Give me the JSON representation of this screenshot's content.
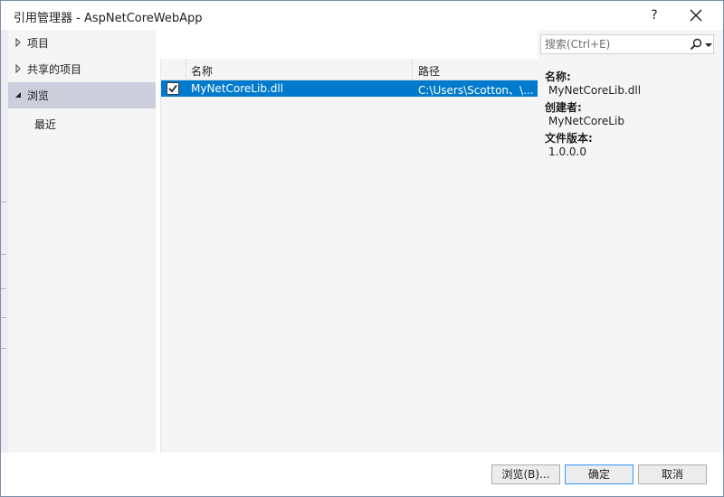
{
  "window": {
    "title": "引用管理器 - AspNetCoreWebApp",
    "help_label": "?"
  },
  "sidebar": {
    "items": [
      {
        "label": "项目",
        "expanded": false
      },
      {
        "label": "共享的项目",
        "expanded": false
      },
      {
        "label": "浏览",
        "expanded": true,
        "selected": true
      },
      {
        "label": "最近",
        "child": true
      }
    ]
  },
  "list": {
    "columns": [
      "名称",
      "路径"
    ],
    "rows": [
      {
        "checked": true,
        "name": "MyNetCoreLib.dll",
        "path": "C:\\Users\\Scotton、\\..."
      }
    ]
  },
  "search": {
    "placeholder": "搜索(Ctrl+E)"
  },
  "details": {
    "name_label": "名称:",
    "name_value": "MyNetCoreLib.dll",
    "creator_label": "创建者:",
    "creator_value": "MyNetCoreLib",
    "version_label": "文件版本:",
    "version_value": "1.0.0.0"
  },
  "footer": {
    "browse_label": "浏览(B)...",
    "ok_label": "确定",
    "cancel_label": "取消"
  },
  "colors": {
    "selection": "#007acc",
    "sidebar_selected": "#cccedb",
    "panel_bg": "#f5f5f5",
    "primary_border": "#3399ff"
  }
}
